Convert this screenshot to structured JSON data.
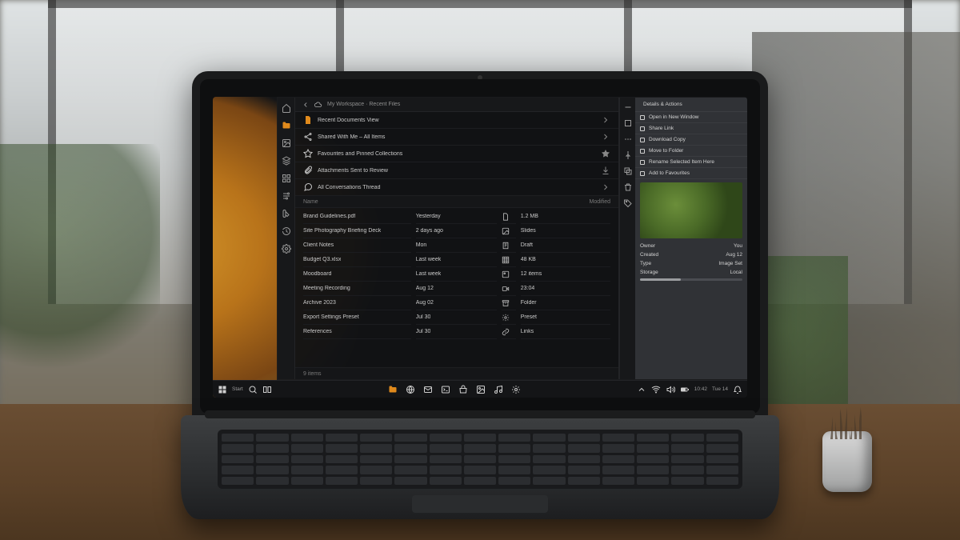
{
  "titlebar": {
    "breadcrumb": "My Workspace · Recent Files"
  },
  "iconbar": {
    "items": [
      {
        "name": "home-icon"
      },
      {
        "name": "folder-icon"
      },
      {
        "name": "image-icon"
      },
      {
        "name": "layers-icon"
      },
      {
        "name": "grid-icon"
      },
      {
        "name": "adjust-icon"
      },
      {
        "name": "swatch-icon"
      },
      {
        "name": "history-icon"
      },
      {
        "name": "settings-icon"
      }
    ],
    "active_index": 1
  },
  "top_list": [
    {
      "label": "Recent Documents View",
      "icon": "document-icon",
      "accent": true,
      "action": "chevron-right-icon"
    },
    {
      "label": "Shared With Me – All Items",
      "icon": "share-icon",
      "action": "chevron-right-icon"
    },
    {
      "label": "Favourites and Pinned Collections",
      "icon": "star-icon",
      "action": "star-icon"
    },
    {
      "label": "Attachments Sent to Review",
      "icon": "paperclip-icon",
      "action": "download-icon"
    },
    {
      "label": "All Conversations Thread",
      "icon": "chat-icon",
      "action": "chevron-right-icon"
    }
  ],
  "section": {
    "col_a": "Name",
    "col_b": "Modified"
  },
  "grid": [
    {
      "a": "Brand Guidelines.pdf",
      "b": "Yesterday",
      "icon": "file-icon",
      "c": "1.2 MB"
    },
    {
      "a": "Site Photography Briefing Deck",
      "b": "2 days ago",
      "icon": "image-icon",
      "c": "Slides"
    },
    {
      "a": "Client Notes",
      "b": "Mon",
      "icon": "note-icon",
      "c": "Draft"
    },
    {
      "a": "Budget Q3.xlsx",
      "b": "Last week",
      "icon": "table-icon",
      "c": "48 KB"
    },
    {
      "a": "Moodboard",
      "b": "Last week",
      "icon": "image-icon",
      "c": "12 items"
    },
    {
      "a": "Meeting Recording",
      "b": "Aug 12",
      "icon": "video-icon",
      "c": "23:04"
    },
    {
      "a": "Archive 2023",
      "b": "Aug 02",
      "icon": "archive-icon",
      "c": "Folder"
    },
    {
      "a": "Export Settings Preset",
      "b": "Jul 30",
      "icon": "gear-icon",
      "c": "Preset"
    },
    {
      "a": "References",
      "b": "Jul 30",
      "icon": "link-icon",
      "c": "Links"
    }
  ],
  "grid_footer": "9 items",
  "rightpanel": {
    "header": "Details & Actions",
    "items": [
      {
        "label": "Open in New Window"
      },
      {
        "label": "Share Link"
      },
      {
        "label": "Download Copy"
      },
      {
        "label": "Move to Folder"
      },
      {
        "label": "Rename Selected Item Here"
      },
      {
        "label": "Add to Favourites"
      }
    ],
    "meta": [
      {
        "label": "Owner",
        "value": "You"
      },
      {
        "label": "Created",
        "value": "Aug 12"
      },
      {
        "label": "Type",
        "value": "Image Set"
      },
      {
        "label": "Storage",
        "value": "Local"
      }
    ]
  },
  "taskbar": {
    "left_label": "Start",
    "clock": "10:42",
    "date": "Tue 14"
  },
  "colors": {
    "accent": "#e08a1c",
    "panel": "#17181a",
    "panel_light": "#303236"
  }
}
